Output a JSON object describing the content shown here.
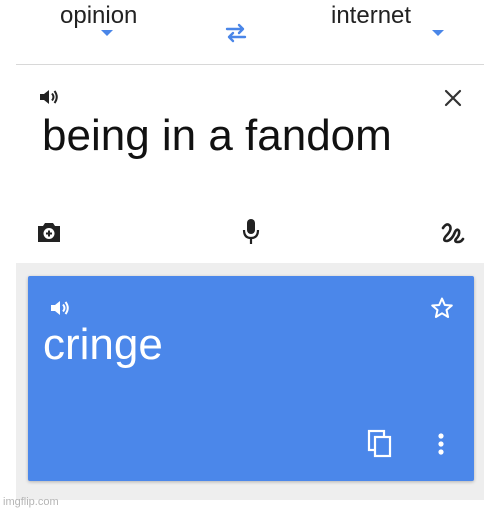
{
  "languages": {
    "source": "opinion",
    "target": "internet"
  },
  "input": {
    "text": "being in a fandom"
  },
  "output": {
    "text": "cringe"
  },
  "colors": {
    "accent": "#4a86e8",
    "output_card": "#4b87ea"
  },
  "icons": [
    "volume-icon",
    "close-icon",
    "camera-icon",
    "microphone-icon",
    "handwriting-icon",
    "swap-icon",
    "star-icon",
    "copy-icon",
    "more-vert-icon"
  ],
  "watermark": "imgflip.com"
}
